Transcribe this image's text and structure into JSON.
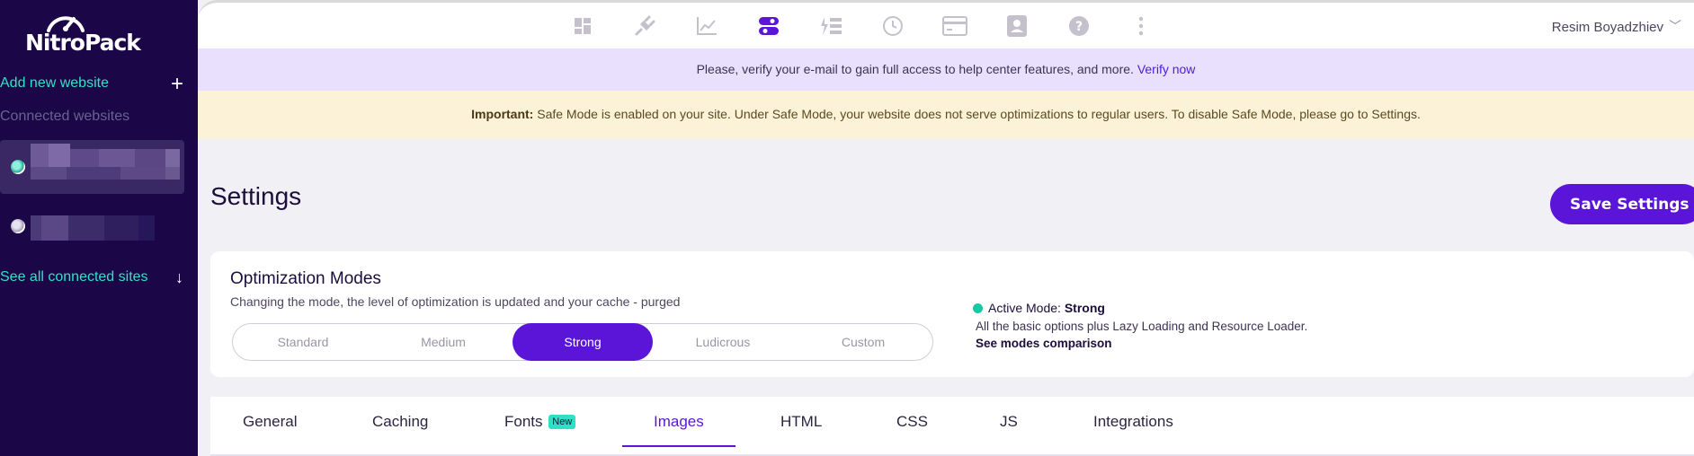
{
  "sidebar": {
    "logo_text": "NitroPack",
    "add_website": "Add new website",
    "connected_label": "Connected websites",
    "see_all": "See all connected sites"
  },
  "topnav": {
    "icons": [
      "dashboard-icon",
      "plug-icon",
      "chart-icon",
      "toggles-icon",
      "list-bolt-icon",
      "history-icon",
      "card-icon",
      "contact-icon",
      "help-icon",
      "more-icon"
    ],
    "active_index": 3,
    "user_name": "Resim Boyadzhiev"
  },
  "banners": {
    "verify_text": "Please, verify your e-mail to gain full access to help center features, and more.",
    "verify_link": "Verify now",
    "important_label": "Important:",
    "important_text": "Safe Mode is enabled on your site. Under Safe Mode, your website does not serve optimizations to regular users. To disable Safe Mode, please go to Settings."
  },
  "page": {
    "title": "Settings",
    "save_button": "Save Settings"
  },
  "modes": {
    "title": "Optimization Modes",
    "subtitle": "Changing the mode, the level of optimization is updated and your cache - purged",
    "options": [
      "Standard",
      "Medium",
      "Strong",
      "Ludicrous",
      "Custom"
    ],
    "selected": "Strong",
    "active_label": "Active Mode:",
    "active_value": "Strong",
    "active_desc": "All the basic options plus Lazy Loading and Resource Loader.",
    "comparison_link": "See modes comparison"
  },
  "tabs": {
    "items": [
      "General",
      "Caching",
      "Fonts",
      "Images",
      "HTML",
      "CSS",
      "JS",
      "Integrations"
    ],
    "new_badge": "New",
    "active": "Images"
  },
  "colors": {
    "sidebar_bg": "#1b0747",
    "accent": "#5a15d9",
    "teal": "#34e0c4"
  }
}
